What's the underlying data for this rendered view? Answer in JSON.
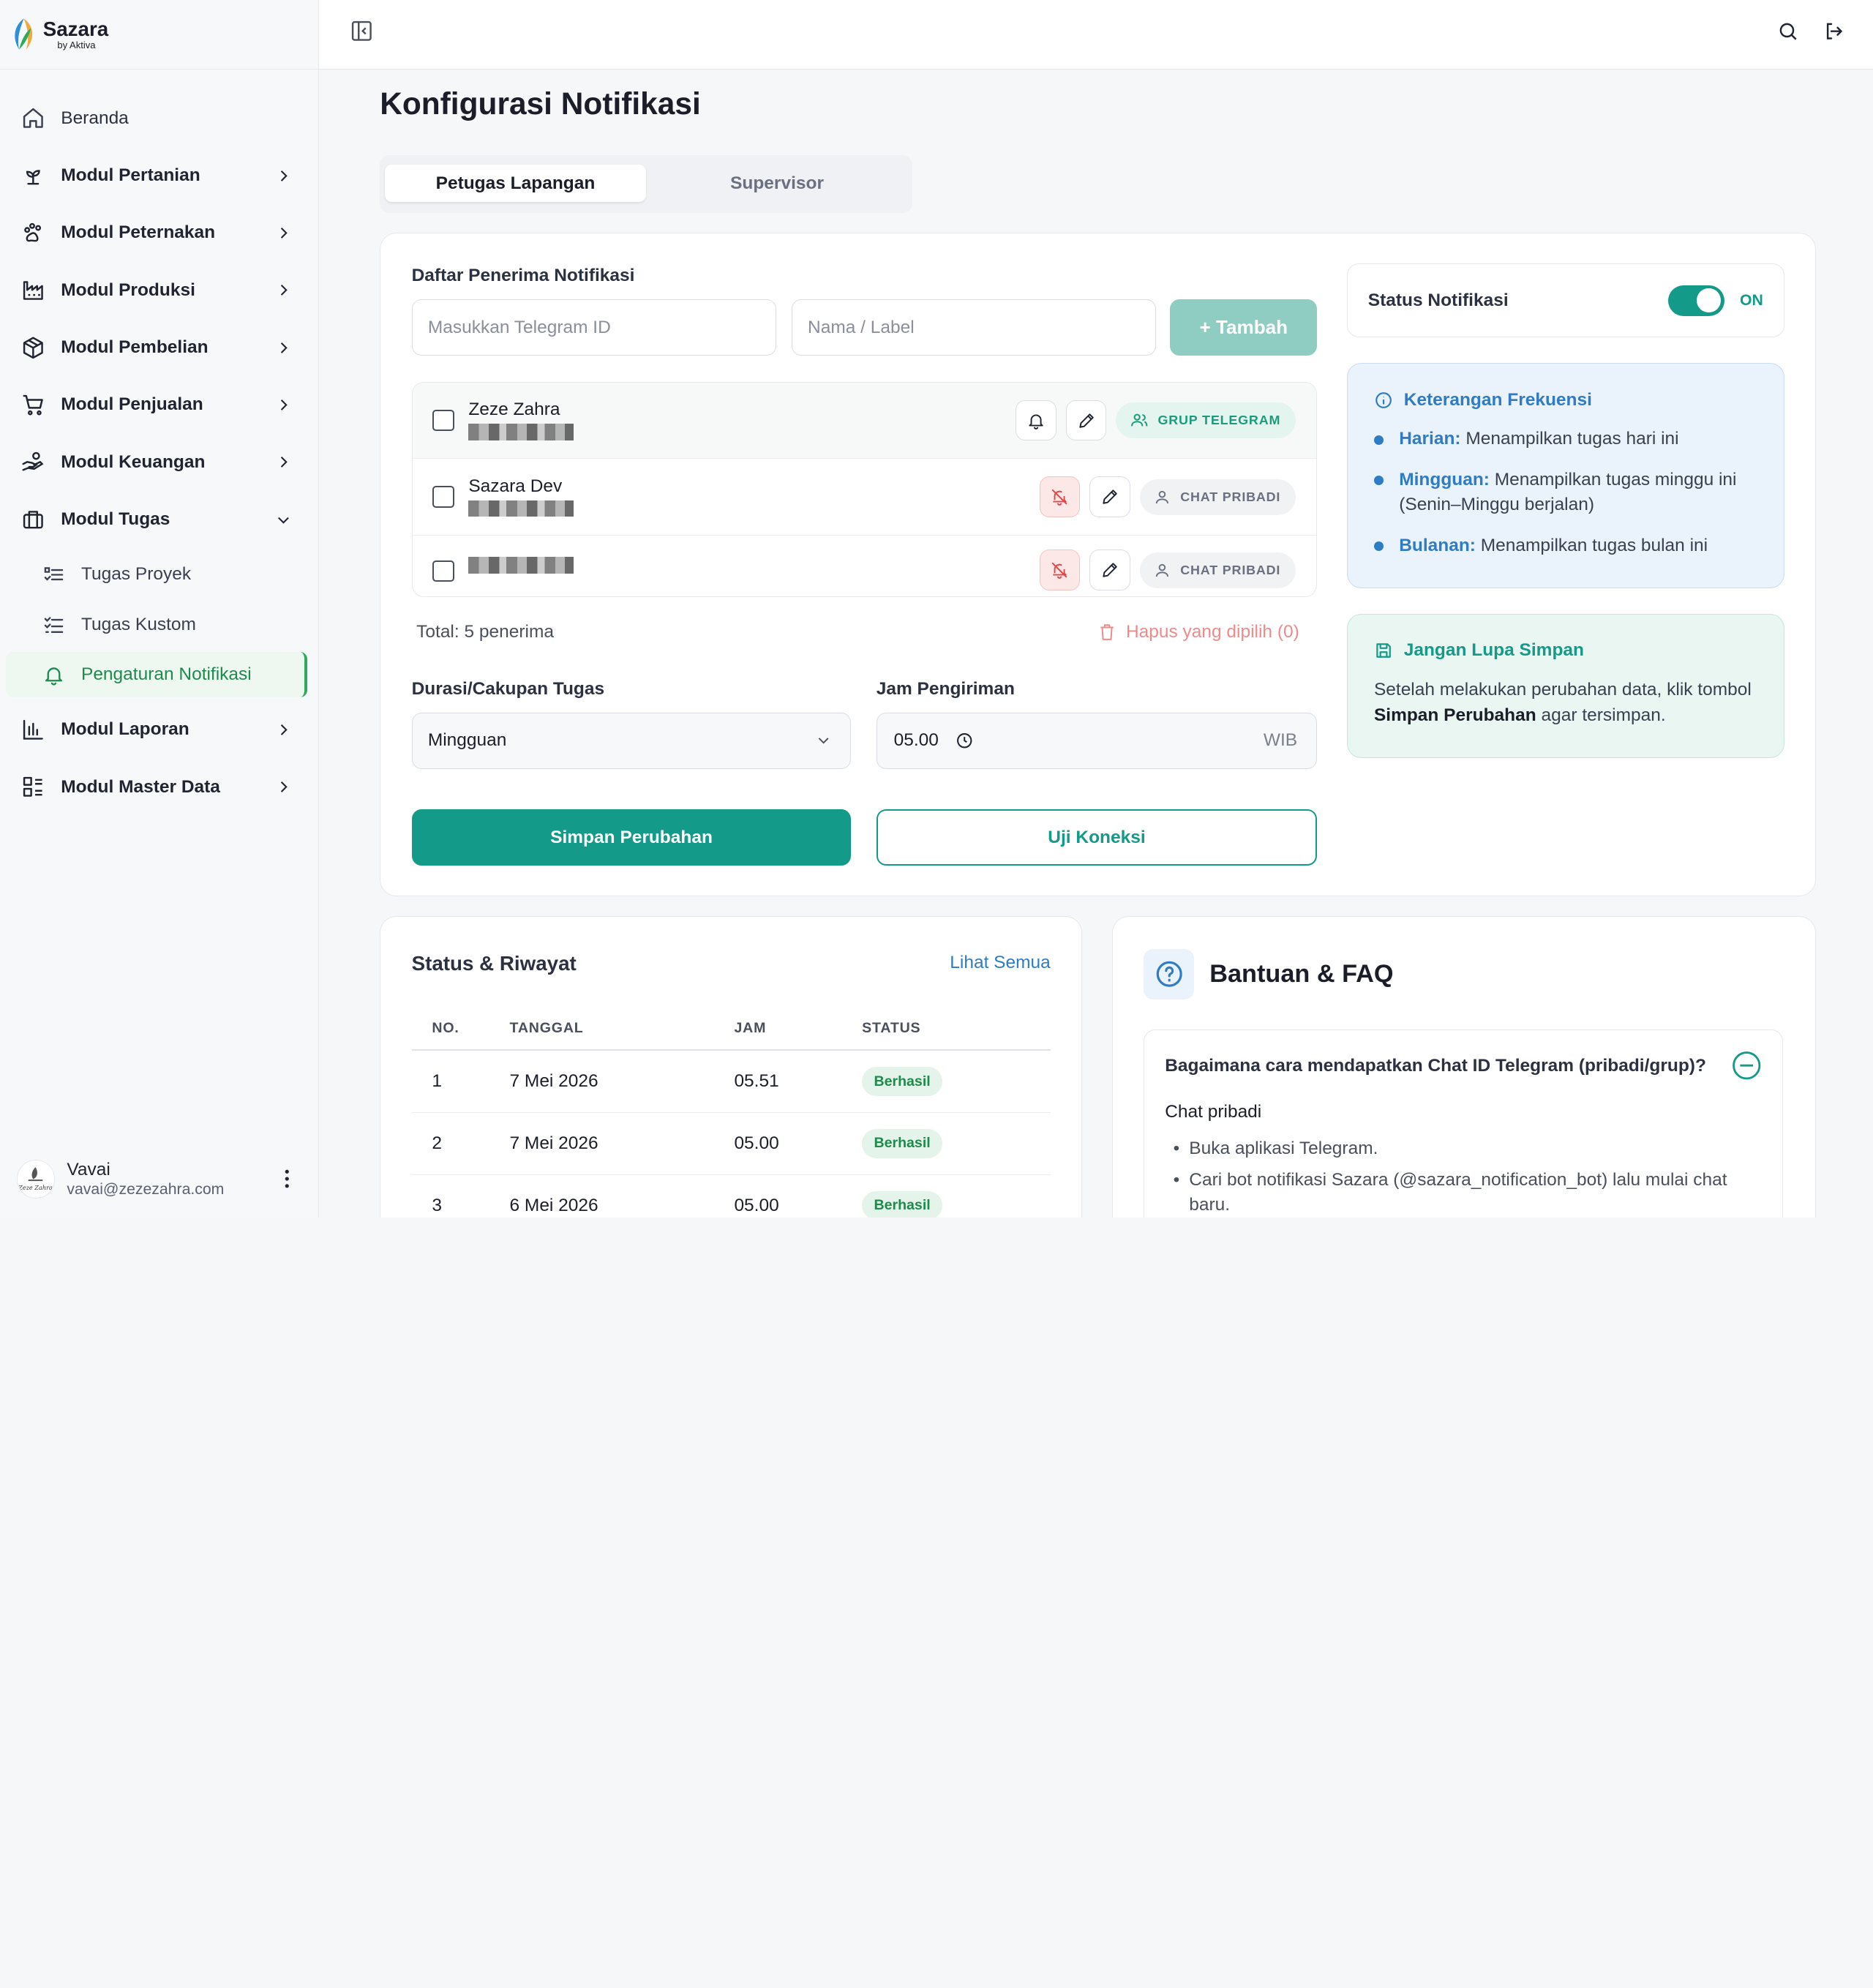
{
  "brand": {
    "name": "Sazara",
    "sub": "by Aktiva"
  },
  "sidebar": {
    "items": [
      {
        "label": "Beranda",
        "icon": "home-icon"
      },
      {
        "label": "Modul Pertanian",
        "icon": "sprout-icon"
      },
      {
        "label": "Modul Peternakan",
        "icon": "paw-icon"
      },
      {
        "label": "Modul Produksi",
        "icon": "factory-icon"
      },
      {
        "label": "Modul Pembelian",
        "icon": "package-icon"
      },
      {
        "label": "Modul Penjualan",
        "icon": "cart-icon"
      },
      {
        "label": "Modul Keuangan",
        "icon": "hand-coins-icon"
      },
      {
        "label": "Modul Tugas",
        "icon": "briefcase-icon"
      },
      {
        "label": "Modul Laporan",
        "icon": "bar-chart-icon"
      },
      {
        "label": "Modul Master Data",
        "icon": "list-icon"
      }
    ],
    "sub_items": [
      {
        "label": "Tugas Proyek",
        "icon": "list-checks-icon"
      },
      {
        "label": "Tugas Kustom",
        "icon": "list-todo-icon"
      },
      {
        "label": "Pengaturan Notifikasi",
        "icon": "bell-icon"
      }
    ]
  },
  "user": {
    "name": "Vavai",
    "email": "vavai@zezezahra.com",
    "avatar_text": "Zeze Zahra"
  },
  "page": {
    "title": "Konfigurasi Notifikasi"
  },
  "tabs": [
    {
      "label": "Petugas Lapangan",
      "active": true
    },
    {
      "label": "Supervisor",
      "active": false
    }
  ],
  "recipients": {
    "section_label": "Daftar Penerima Notifikasi",
    "telegram_placeholder": "Masukkan Telegram ID",
    "name_placeholder": "Nama / Label",
    "add_label": "+ Tambah",
    "rows": [
      {
        "name": "Zeze Zahra",
        "type": "GRUP TELEGRAM",
        "notify": true
      },
      {
        "name": "Sazara Dev",
        "type": "CHAT PRIBADI",
        "notify": false
      },
      {
        "name": "",
        "type": "CHAT PRIBADI",
        "notify": false
      }
    ],
    "total": "Total: 5 penerima",
    "delete_selected": "Hapus yang dipilih (0)"
  },
  "schedule": {
    "scope_label": "Durasi/Cakupan Tugas",
    "scope_value": "Mingguan",
    "time_label": "Jam Pengiriman",
    "time_value": "05.00",
    "time_unit": "WIB"
  },
  "actions": {
    "save": "Simpan Perubahan",
    "test": "Uji Koneksi"
  },
  "status": {
    "label": "Status Notifikasi",
    "value": "ON",
    "enabled": true
  },
  "frequency": {
    "title": "Keterangan Frekuensi",
    "items": [
      {
        "term": "Harian:",
        "desc": "Menampilkan tugas hari ini"
      },
      {
        "term": "Mingguan:",
        "desc": "Menampilkan tugas minggu ini (Senin–Minggu berjalan)"
      },
      {
        "term": "Bulanan:",
        "desc": "Menampilkan tugas bulan ini"
      }
    ]
  },
  "reminder": {
    "title": "Jangan Lupa Simpan",
    "text_before": "Setelah melakukan perubahan data, klik tombol",
    "text_bold": "Simpan Perubahan",
    "text_after": "agar tersimpan."
  },
  "history": {
    "title": "Status & Riwayat",
    "see_all": "Lihat Semua",
    "columns": [
      "NO.",
      "TANGGAL",
      "JAM",
      "STATUS"
    ],
    "rows": [
      {
        "no": "1",
        "date": "7 Mei 2026",
        "time": "05.51",
        "status": "Berhasil"
      },
      {
        "no": "2",
        "date": "7 Mei 2026",
        "time": "05.00",
        "status": "Berhasil"
      },
      {
        "no": "3",
        "date": "6 Mei 2026",
        "time": "05.00",
        "status": "Berhasil"
      }
    ]
  },
  "faq": {
    "title": "Bantuan & FAQ",
    "question": "Bagaimana cara mendapatkan Chat ID Telegram (pribadi/grup)?",
    "sub": "Chat pribadi",
    "steps": [
      "Buka aplikasi Telegram.",
      "Cari bot notifikasi Sazara (@sazara_notification_bot) lalu mulai chat baru."
    ]
  },
  "colors": {
    "primary": "#139a88",
    "accent_blue": "#2f7cc4",
    "active_nav": "#1d8a4e"
  }
}
